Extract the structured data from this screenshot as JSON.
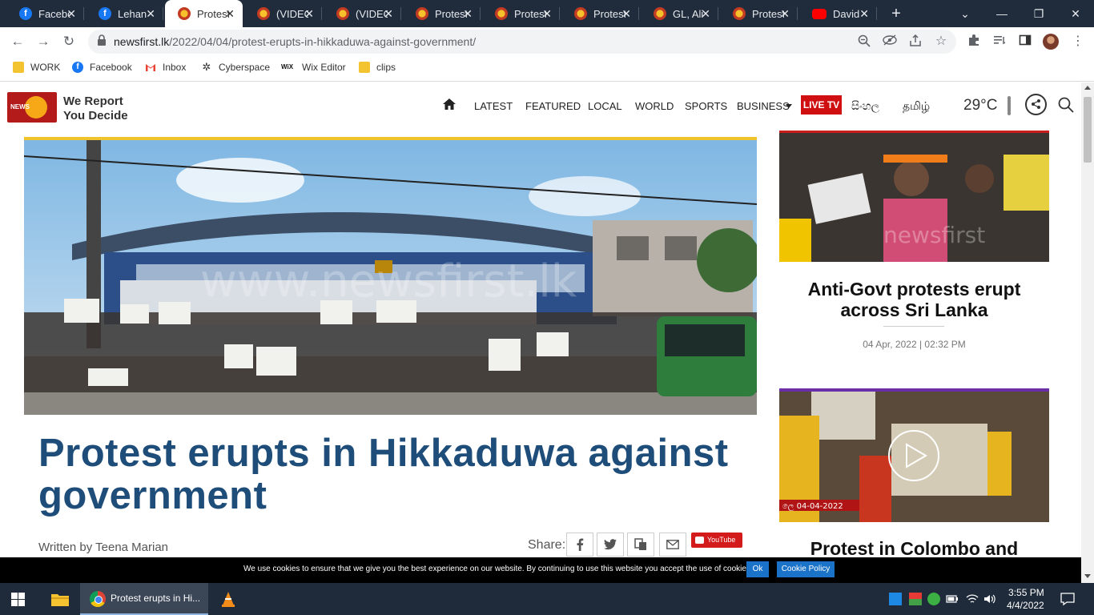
{
  "browser": {
    "tabs": [
      {
        "title": "Facebook",
        "favicon": "facebook-icon",
        "active": false
      },
      {
        "title": "Lehan",
        "favicon": "facebook-icon",
        "active": false
      },
      {
        "title": "Protest",
        "favicon": "newsfirst-icon",
        "active": true
      },
      {
        "title": "(VIDEO",
        "favicon": "newsfirst-icon",
        "active": false
      },
      {
        "title": "(VIDEO",
        "favicon": "newsfirst-icon",
        "active": false
      },
      {
        "title": "Protest",
        "favicon": "newsfirst-icon",
        "active": false
      },
      {
        "title": "Protest",
        "favicon": "newsfirst-icon",
        "active": false
      },
      {
        "title": "Protest",
        "favicon": "newsfirst-icon",
        "active": false
      },
      {
        "title": "GL, Ali",
        "favicon": "newsfirst-icon",
        "active": false
      },
      {
        "title": "Protest",
        "favicon": "newsfirst-icon",
        "active": false
      },
      {
        "title": "David",
        "favicon": "youtube-icon",
        "active": false
      }
    ],
    "url_host": "newsfirst.lk",
    "url_path": "/2022/04/04/protest-erupts-in-hikkaduwa-against-government/",
    "bookmarks": [
      {
        "label": "WORK",
        "icon": "folder-icon"
      },
      {
        "label": "Facebook",
        "icon": "facebook-icon"
      },
      {
        "label": "Inbox",
        "icon": "gmail-icon"
      },
      {
        "label": "Cyberspace",
        "icon": "cyberspace-icon"
      },
      {
        "label": "Wix Editor",
        "icon": "wix-icon"
      },
      {
        "label": "clips",
        "icon": "folder-icon"
      }
    ]
  },
  "site": {
    "tagline_line1": "We Report",
    "tagline_line2": "You Decide",
    "nav": [
      "LATEST",
      "FEATURED",
      "LOCAL",
      "WORLD",
      "SPORTS",
      "BUSINESS"
    ],
    "live_tv": "LIVE TV",
    "lang_sinhala": "සිංහල",
    "lang_tamil": "தமிழ்",
    "temperature": "29°C",
    "accent_color": "#1e4d7a",
    "live_color": "#d01010"
  },
  "article": {
    "headline": "Protest erupts in Hikkaduwa against government",
    "byline": "Written by Teena Marian",
    "share_label": "Share:",
    "youtube_label": "YouTube"
  },
  "sidebar": {
    "card1_title": "Anti-Govt protests erupt across Sri Lanka",
    "card1_date": "04 Apr, 2022 | 02:32 PM",
    "card2_title": "Protest in Colombo and",
    "card2_overlay_date": "ලෙ 04-04-2022"
  },
  "cookie": {
    "text": "We use cookies to ensure that we give you the best experience on our website. By continuing to use this website you accept the use of cookies.",
    "ok": "Ok",
    "policy": "Cookie Policy"
  },
  "taskbar": {
    "chrome_label": "Protest erupts in Hi...",
    "time": "3:55 PM",
    "date": "4/4/2022"
  }
}
